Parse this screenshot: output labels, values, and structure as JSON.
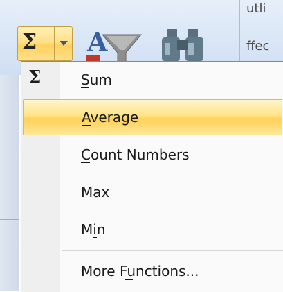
{
  "ribbon": {
    "autosum_icon": "sigma-icon",
    "filter_icon": "sort-filter-icon",
    "find_icon": "find-binoculars-icon",
    "snippet_line1": "utli",
    "snippet_line2": "ffec"
  },
  "menu": {
    "items": [
      {
        "label": "Sum",
        "icon": "Σ",
        "access_key": "S",
        "highlighted": false
      },
      {
        "label": "Average",
        "access_key": "A",
        "highlighted": true
      },
      {
        "label": "Count Numbers",
        "access_key": "C",
        "highlighted": false
      },
      {
        "label": "Max",
        "access_key": "M",
        "highlighted": false
      },
      {
        "label": "Min",
        "access_key": "i",
        "highlighted": false
      },
      {
        "label": "More Functions...",
        "access_key": "F",
        "highlighted": false
      }
    ]
  },
  "colors": {
    "highlight": "#ffd75f",
    "ribbon": "#dbe7f5",
    "menu_bg": "#fafafa"
  }
}
